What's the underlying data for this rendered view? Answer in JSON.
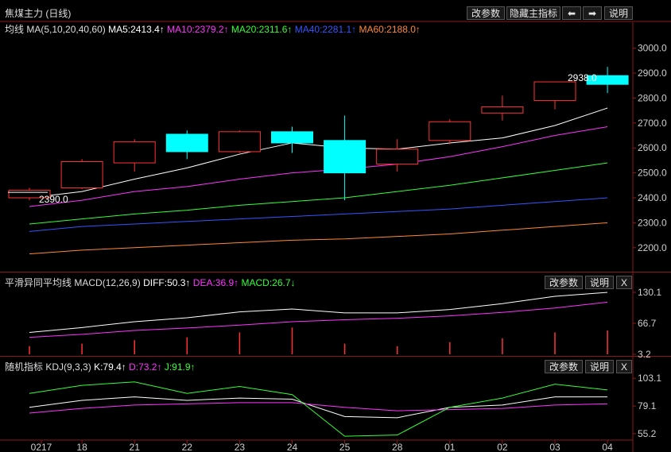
{
  "header": {
    "title": "焦煤主力 (日线)",
    "buttons": [
      "改参数",
      "隐藏主指标",
      "⬅",
      "➡",
      "说明"
    ]
  },
  "ma_legend": {
    "label": "均线",
    "params": "MA(5,10,20,40,60)",
    "items": [
      {
        "text": "MA5:2413.4↑",
        "color": "#ffffff"
      },
      {
        "text": "MA10:2379.2↑",
        "color": "#ff33ff"
      },
      {
        "text": "MA20:2311.6↑",
        "color": "#33ff33"
      },
      {
        "text": "MA40:2281.1↑",
        "color": "#3355ff"
      },
      {
        "text": "MA60:2188.0↑",
        "color": "#ff8833"
      }
    ]
  },
  "macd_legend": {
    "label": "平滑异同平均线",
    "params": "MACD(12,26,9)",
    "items": [
      {
        "text": "DIFF:50.3↑",
        "color": "#ffffff"
      },
      {
        "text": "DEA:36.9↑",
        "color": "#ff33ff"
      },
      {
        "text": "MACD:26.7↓",
        "color": "#33ff33"
      }
    ],
    "buttons": [
      "改参数",
      "说明",
      "X"
    ]
  },
  "kdj_legend": {
    "label": "随机指标",
    "params": "KDJ(9,3,3)",
    "items": [
      {
        "text": "K:79.4↑",
        "color": "#ffffff"
      },
      {
        "text": "D:73.2↑",
        "color": "#ff33ff"
      },
      {
        "text": "J:91.9↑",
        "color": "#33ff33"
      }
    ],
    "buttons": [
      "改参数",
      "说明",
      "X"
    ]
  },
  "colors": {
    "up": "#ff3333",
    "down": "#00ffff",
    "axis": "#8a1a1a",
    "grid": "#3a0a0a"
  },
  "chart_data": [
    {
      "type": "candlestick",
      "title": "焦煤主力 (日线)",
      "categories": [
        "0217",
        "18",
        "21",
        "22",
        "23",
        "24",
        "25",
        "28",
        "01",
        "02",
        "03",
        "04"
      ],
      "ylim": [
        2110,
        3050
      ],
      "yticks": [
        2200.0,
        2300.0,
        2400.0,
        2500.0,
        2600.0,
        2700.0,
        2800.0,
        2900.0,
        3000.0
      ],
      "annotations": [
        {
          "label": "2390.0"
        },
        {
          "label": "2938.0"
        }
      ],
      "candles": [
        {
          "o": 2400,
          "h": 2440,
          "l": 2390,
          "c": 2430
        },
        {
          "o": 2440,
          "h": 2555,
          "l": 2435,
          "c": 2545
        },
        {
          "o": 2540,
          "h": 2635,
          "l": 2505,
          "c": 2625
        },
        {
          "o": 2655,
          "h": 2670,
          "l": 2555,
          "c": 2585
        },
        {
          "o": 2585,
          "h": 2670,
          "l": 2580,
          "c": 2665
        },
        {
          "o": 2665,
          "h": 2685,
          "l": 2580,
          "c": 2620
        },
        {
          "o": 2630,
          "h": 2730,
          "l": 2390,
          "c": 2500
        },
        {
          "o": 2535,
          "h": 2635,
          "l": 2505,
          "c": 2595
        },
        {
          "o": 2630,
          "h": 2715,
          "l": 2615,
          "c": 2705
        },
        {
          "o": 2740,
          "h": 2810,
          "l": 2710,
          "c": 2765
        },
        {
          "o": 2790,
          "h": 2865,
          "l": 2755,
          "c": 2865
        },
        {
          "o": 2890,
          "h": 2925,
          "l": 2820,
          "c": 2855
        }
      ],
      "series": [
        {
          "name": "MA5",
          "values": [
            2400,
            2425,
            2475,
            2520,
            2575,
            2620,
            2600,
            2595,
            2620,
            2640,
            2690,
            2760
          ]
        },
        {
          "name": "MA10",
          "values": [
            2365,
            2390,
            2425,
            2445,
            2475,
            2500,
            2515,
            2535,
            2565,
            2605,
            2650,
            2685
          ]
        },
        {
          "name": "MA20",
          "values": [
            2295,
            2315,
            2335,
            2350,
            2370,
            2385,
            2400,
            2425,
            2450,
            2480,
            2510,
            2540
          ]
        },
        {
          "name": "MA40",
          "values": [
            2265,
            2285,
            2295,
            2305,
            2315,
            2325,
            2335,
            2345,
            2355,
            2370,
            2385,
            2400
          ]
        },
        {
          "name": "MA60",
          "values": [
            2175,
            2190,
            2200,
            2210,
            2220,
            2230,
            2235,
            2245,
            2255,
            2270,
            2285,
            2300
          ]
        }
      ]
    },
    {
      "type": "line",
      "title": "MACD(12,26,9)",
      "categories": [
        "0217",
        "18",
        "21",
        "22",
        "23",
        "24",
        "25",
        "28",
        "01",
        "02",
        "03",
        "04"
      ],
      "ylim": [
        3.2,
        130.1
      ],
      "yticks": [
        130.1,
        66.7,
        3.2
      ],
      "series": [
        {
          "name": "DIFF",
          "values": [
            48,
            58,
            70,
            78,
            90,
            96,
            88,
            88,
            95,
            107,
            122,
            130
          ]
        },
        {
          "name": "DEA",
          "values": [
            38,
            44,
            52,
            57,
            63,
            70,
            74,
            77,
            82,
            89,
            98,
            110
          ]
        },
        {
          "name": "MACD",
          "values": [
            20,
            25,
            32,
            38,
            48,
            58,
            25,
            20,
            28,
            36,
            48,
            52
          ]
        }
      ]
    },
    {
      "type": "line",
      "title": "KDJ(9,3,3)",
      "categories": [
        "0217",
        "18",
        "21",
        "22",
        "23",
        "24",
        "25",
        "28",
        "01",
        "02",
        "03",
        "04"
      ],
      "ylim": [
        51,
        106
      ],
      "yticks": [
        103.1,
        79.1,
        55.2
      ],
      "series": [
        {
          "name": "K",
          "values": [
            78,
            84,
            87,
            84,
            86,
            85,
            70,
            69,
            78,
            80,
            87,
            87
          ]
        },
        {
          "name": "D",
          "values": [
            73,
            77,
            80,
            81,
            82,
            82,
            78,
            75,
            76,
            77,
            80,
            81
          ]
        },
        {
          "name": "J",
          "values": [
            90,
            97,
            100,
            90,
            96,
            89,
            53,
            54,
            78,
            86,
            98,
            93
          ]
        }
      ]
    }
  ]
}
